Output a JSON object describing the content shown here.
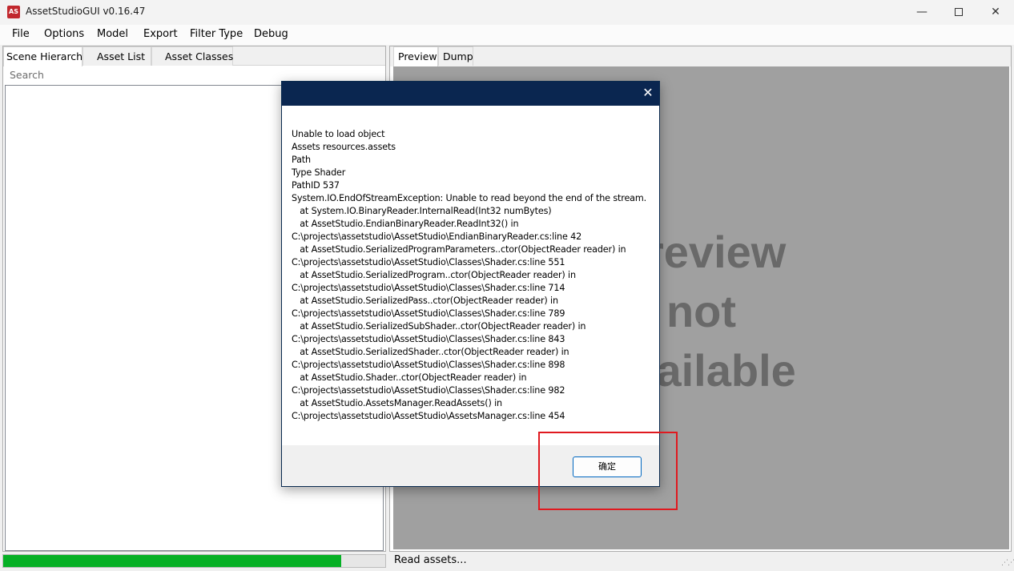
{
  "window": {
    "title": "AssetStudioGUI v0.16.47",
    "icon_label": "AS",
    "minimize": "—",
    "close": "✕"
  },
  "menu": [
    "File",
    "Options",
    "Model",
    "Export",
    "Filter Type",
    "Debug"
  ],
  "left_tabs": [
    "Scene Hierarchy",
    "Asset List",
    "Asset Classes"
  ],
  "search": {
    "placeholder": "Search"
  },
  "progress": {
    "fraction": 0.885,
    "color": "#06b025"
  },
  "right_tabs": [
    "Preview",
    "Dump"
  ],
  "preview": {
    "lines": [
      "Preview",
      "not",
      "available"
    ]
  },
  "status": {
    "text": "Read assets..."
  },
  "dialog": {
    "close_glyph": "✕",
    "message": "Unable to load object\nAssets resources.assets\nPath\nType Shader\nPathID 537\nSystem.IO.EndOfStreamException: Unable to read beyond the end of the stream.\n   at System.IO.BinaryReader.InternalRead(Int32 numBytes)\n   at AssetStudio.EndianBinaryReader.ReadInt32() in\nC:\\projects\\assetstudio\\AssetStudio\\EndianBinaryReader.cs:line 42\n   at AssetStudio.SerializedProgramParameters..ctor(ObjectReader reader) in\nC:\\projects\\assetstudio\\AssetStudio\\Classes\\Shader.cs:line 551\n   at AssetStudio.SerializedProgram..ctor(ObjectReader reader) in\nC:\\projects\\assetstudio\\AssetStudio\\Classes\\Shader.cs:line 714\n   at AssetStudio.SerializedPass..ctor(ObjectReader reader) in\nC:\\projects\\assetstudio\\AssetStudio\\Classes\\Shader.cs:line 789\n   at AssetStudio.SerializedSubShader..ctor(ObjectReader reader) in\nC:\\projects\\assetstudio\\AssetStudio\\Classes\\Shader.cs:line 843\n   at AssetStudio.SerializedShader..ctor(ObjectReader reader) in\nC:\\projects\\assetstudio\\AssetStudio\\Classes\\Shader.cs:line 898\n   at AssetStudio.Shader..ctor(ObjectReader reader) in\nC:\\projects\\assetstudio\\AssetStudio\\Classes\\Shader.cs:line 982\n   at AssetStudio.AssetsManager.ReadAssets() in\nC:\\projects\\assetstudio\\AssetStudio\\AssetsManager.cs:line 454",
    "ok_label": "确定"
  },
  "colors": {
    "dialog_title": "#0a2650",
    "preview_bg": "#a0a0a0",
    "highlight": "#e0191f"
  }
}
